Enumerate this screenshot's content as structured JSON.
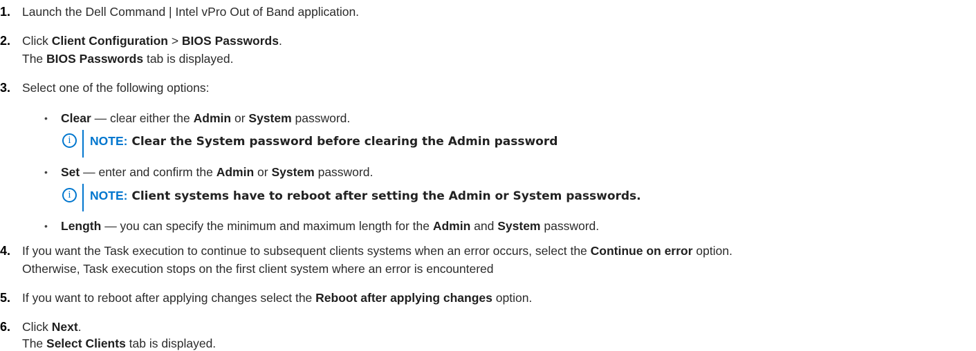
{
  "steps": [
    {
      "number": "1.",
      "text": "Launch the Dell Command | Intel vPro Out of Band application."
    },
    {
      "number": "2.",
      "pre": "Click ",
      "bold1": "Client Configuration",
      "mid": " > ",
      "bold2": "BIOS Passwords",
      "post": ".",
      "sub_pre": "The ",
      "sub_bold": "BIOS Passwords",
      "sub_post": " tab is displayed."
    },
    {
      "number": "3.",
      "text": "Select one of the following options:",
      "options": [
        {
          "bold": "Clear",
          "pre": " — clear either the ",
          "b1": "Admin",
          "mid": " or ",
          "b2": "System",
          "post": " password.",
          "note_label": "NOTE:",
          "note_text": " Clear the System password before clearing the Admin password"
        },
        {
          "bold": "Set",
          "pre": " — enter and confirm the ",
          "b1": "Admin",
          "mid": " or ",
          "b2": "System",
          "post": " password.",
          "note_label": "NOTE:",
          "note_text": " Client systems have to reboot after setting the Admin or System passwords."
        },
        {
          "bold": "Length",
          "pre": " — you can specify the minimum and maximum length for the ",
          "b1": "Admin",
          "mid": " and ",
          "b2": "System",
          "post": " password."
        }
      ]
    },
    {
      "number": "4.",
      "pre": "If you want the Task execution to continue to subsequent clients systems when an error occurs, select the ",
      "bold": "Continue on error",
      "post": " option.",
      "line2": "Otherwise, Task execution stops on the first client system where an error is encountered"
    },
    {
      "number": "5.",
      "pre": "If you want to reboot after applying changes select the ",
      "bold": "Reboot after applying changes",
      "post": " option."
    },
    {
      "number": "6.",
      "pre": "Click ",
      "bold": "Next",
      "post": ".",
      "sub_pre": "The ",
      "sub_bold": "Select Clients",
      "sub_post": " tab is displayed."
    }
  ],
  "note_icon_glyph": "i",
  "bullet_glyph": "•",
  "colors": {
    "accent": "#0076ce",
    "text": "#2b2b2b"
  }
}
